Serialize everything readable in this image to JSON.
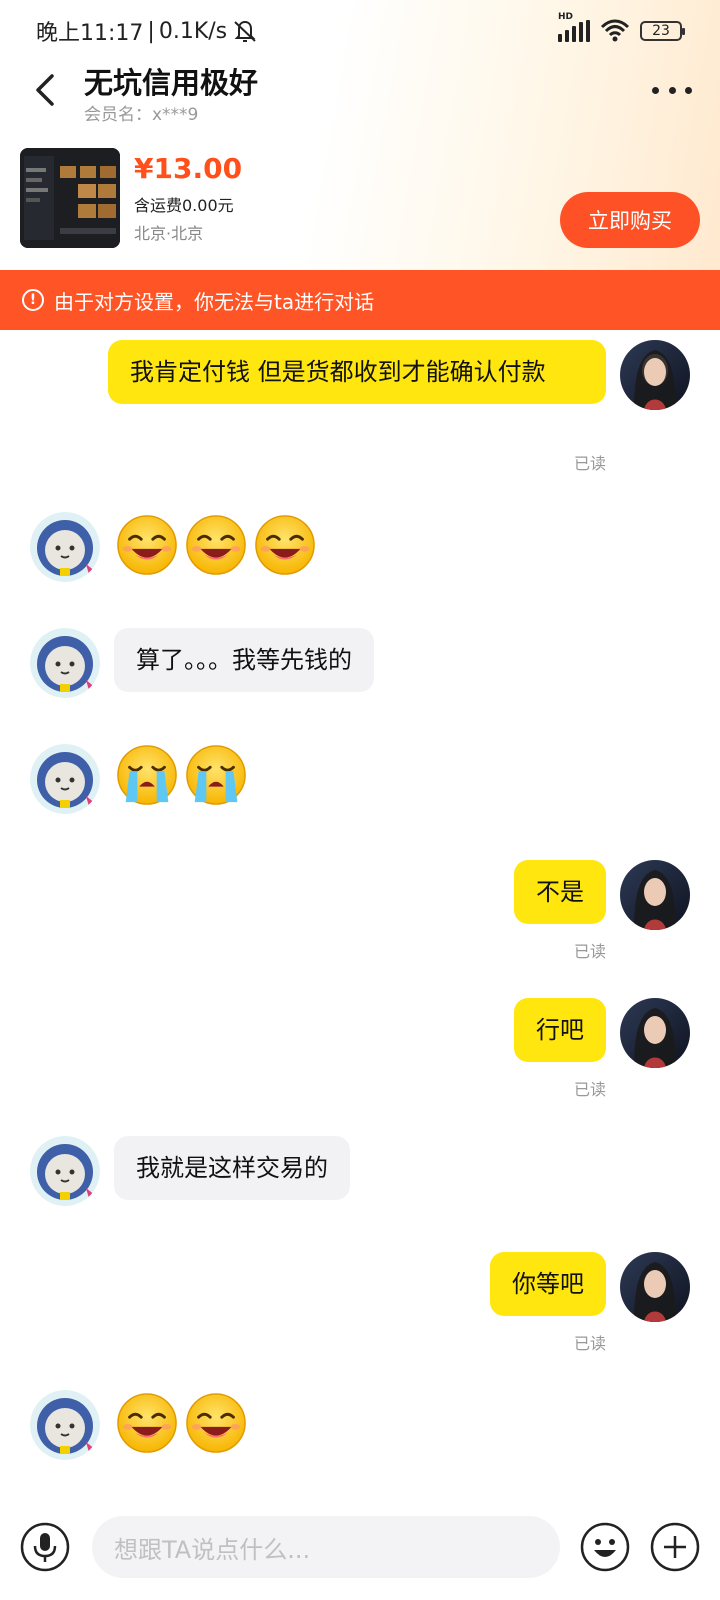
{
  "status_bar": {
    "time": "晚上11:17",
    "separator": "|",
    "speed": "0.1K/s",
    "battery": "23",
    "network_badge": "HD",
    "icons": [
      "mute-icon",
      "signal-icon",
      "wifi-icon",
      "battery-icon"
    ]
  },
  "header": {
    "title": "无坑信用极好",
    "member": "会员名：x***9"
  },
  "product": {
    "price": "¥13.00",
    "shipping": "含运费0.00元",
    "location": "北京·北京",
    "buy_label": "立即购买"
  },
  "warning": {
    "text": "由于对方设置，你无法与ta进行对话",
    "icon": "!"
  },
  "messages": [
    {
      "from": "me",
      "text": "我肯定付钱 但是货都收到才能确认付款",
      "read": "已读"
    },
    {
      "from": "them",
      "emoji": "grin-emoji",
      "count": 3
    },
    {
      "from": "them",
      "text": "算了。。。我等先钱的"
    },
    {
      "from": "them",
      "emoji": "cry-emoji",
      "count": 2
    },
    {
      "from": "me",
      "text": "不是",
      "read": "已读"
    },
    {
      "from": "me",
      "text": "行吧",
      "read": "已读"
    },
    {
      "from": "them",
      "text": "我就是这样交易的"
    },
    {
      "from": "me",
      "text": "你等吧",
      "read": "已读"
    },
    {
      "from": "them",
      "emoji": "grin-emoji",
      "count": 2
    }
  ],
  "input": {
    "placeholder": "想跟TA说点什么..."
  },
  "colors": {
    "accent": "#ff5426",
    "my_bubble": "#ffe60f",
    "their_bubble": "#f2f2f4",
    "price": "#ff4f1a"
  }
}
